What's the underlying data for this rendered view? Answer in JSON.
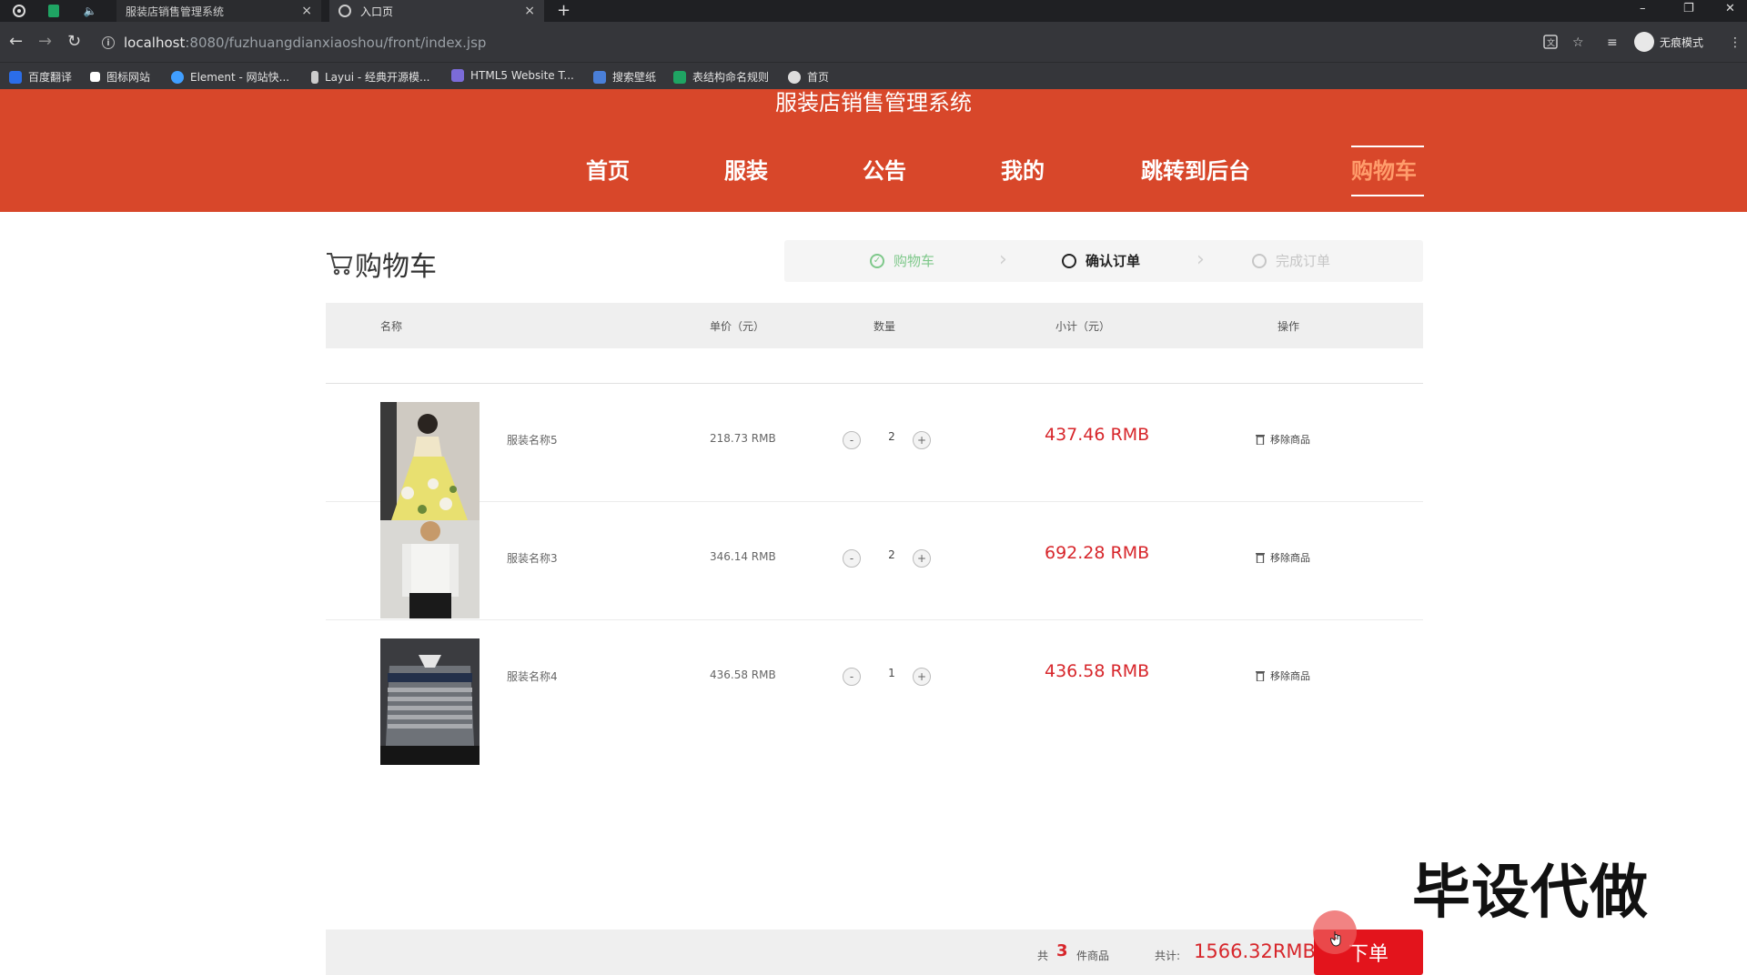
{
  "browser": {
    "tabs": [
      {
        "title": "服装店销售管理系统",
        "close": "×"
      },
      {
        "title": "入口页",
        "close": "×"
      }
    ],
    "new_tab": "+",
    "window_controls": {
      "minimize": "–",
      "restore": "❐",
      "close": "✕"
    },
    "url_host": "localhost",
    "url_path": ":8080/fuzhuangdianxiaoshou/front/index.jsp",
    "profile_label": "无痕模式",
    "bookmarks": [
      {
        "label": "百度翻译",
        "color": "#2b6de8"
      },
      {
        "label": "图标网站",
        "color": "#ffffff"
      },
      {
        "label": "Element - 网站快...",
        "color": "#409eff"
      },
      {
        "label": "Layui - 经典开源模...",
        "color": "#cccccc"
      },
      {
        "label": "HTML5 Website T...",
        "color": "#7b6bd8"
      },
      {
        "label": "搜索壁纸",
        "color": "#4a7fd8"
      },
      {
        "label": "表结构命名规则",
        "color": "#1fa463"
      },
      {
        "label": "首页",
        "color": "#dddddd"
      }
    ]
  },
  "site": {
    "title": "服装店销售管理系统",
    "nav": [
      {
        "label": "首页",
        "active": false
      },
      {
        "label": "服装",
        "active": false
      },
      {
        "label": "公告",
        "active": false
      },
      {
        "label": "我的",
        "active": false
      },
      {
        "label": "跳转到后台",
        "active": false
      },
      {
        "label": "购物车",
        "active": true
      }
    ],
    "accent_color": "#d8472a"
  },
  "cart": {
    "heading": "购物车",
    "steps": [
      {
        "label": "购物车",
        "state": "done"
      },
      {
        "label": "确认订单",
        "state": "current"
      },
      {
        "label": "完成订单",
        "state": "todo"
      }
    ],
    "columns": [
      "名称",
      "单价（元）",
      "数量",
      "小计（元）",
      "操作"
    ],
    "items": [
      {
        "name": "服装名称5",
        "price": "218.73 RMB",
        "qty": "2",
        "subtotal": "437.46 RMB",
        "remove": "移除商品",
        "minus": "-",
        "plus": "+"
      },
      {
        "name": "服装名称3",
        "price": "346.14 RMB",
        "qty": "2",
        "subtotal": "692.28 RMB",
        "remove": "移除商品",
        "minus": "-",
        "plus": "+"
      },
      {
        "name": "服装名称4",
        "price": "436.58 RMB",
        "qty": "1",
        "subtotal": "436.58 RMB",
        "remove": "移除商品",
        "minus": "-",
        "plus": "+"
      }
    ],
    "footer": {
      "count_prefix": "共",
      "count": "3",
      "count_suffix": "件商品",
      "total_label": "共计:",
      "total": "1566.32RMB",
      "order_button": "下单"
    }
  },
  "watermark": "毕设代做"
}
